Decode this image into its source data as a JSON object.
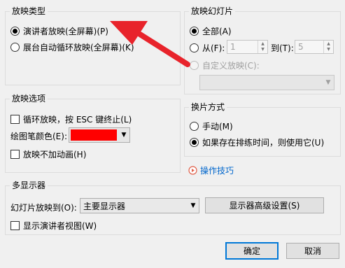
{
  "show_type": {
    "title": "放映类型",
    "presenter": "演讲者放映(全屏幕)(P)",
    "kiosk": "展台自动循环放映(全屏幕)(K)"
  },
  "show_slides": {
    "title": "放映幻灯片",
    "all": "全部(A)",
    "from": "从(F):",
    "from_value": "1",
    "to": "到(T):",
    "to_value": "5",
    "custom": "自定义放映(C):"
  },
  "show_options": {
    "title": "放映选项",
    "loop": "循环放映，按 ESC 键终止(L)",
    "pen_color": "绘图笔颜色(E):",
    "pen_color_value": "#ff0000",
    "no_animation": "放映不加动画(H)"
  },
  "advance": {
    "title": "换片方式",
    "manual": "手动(M)",
    "timings": "如果存在排练时间，则使用它(U)"
  },
  "tips": {
    "label": "操作技巧"
  },
  "multi_monitor": {
    "title": "多显示器",
    "show_on": "幻灯片放映到(O):",
    "monitor_value": "主要显示器",
    "advanced_button": "显示器高级设置(S)",
    "presenter_view": "显示演讲者视图(W)"
  },
  "buttons": {
    "ok": "确定",
    "cancel": "取消"
  },
  "annotation": {
    "arrow_color": "#e8232b"
  }
}
